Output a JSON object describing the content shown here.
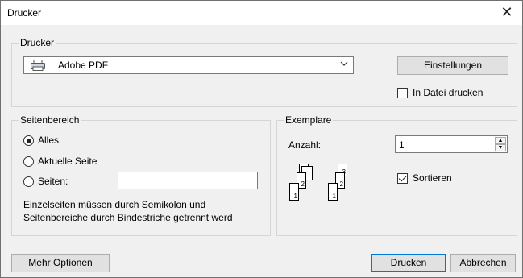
{
  "window": {
    "title": "Drucker"
  },
  "printer": {
    "group_label": "Drucker",
    "selected": "Adobe PDF",
    "settings_button": "Einstellungen",
    "print_to_file_label": "In Datei drucken",
    "print_to_file_checked": false
  },
  "range": {
    "group_label": "Seitenbereich",
    "options": [
      {
        "label": "Alles",
        "selected": true
      },
      {
        "label": "Aktuelle Seite",
        "selected": false
      },
      {
        "label": "Seiten:",
        "selected": false
      }
    ],
    "pages_value": "",
    "note_line1": "Einzelseiten müssen durch Semikolon und",
    "note_line2": "Seitenbereiche durch Bindestriche getrennt werd"
  },
  "copies": {
    "group_label": "Exemplare",
    "count_label": "Anzahl:",
    "count_value": "1",
    "collate_label": "Sortieren",
    "collate_checked": true
  },
  "footer": {
    "more_options": "Mehr Optionen",
    "print": "Drucken",
    "cancel": "Abbrechen"
  },
  "icons": {
    "close": "close-icon",
    "printer": "printer-icon",
    "dropdown": "chevron-down-icon",
    "collate": "collate-pages-icon"
  },
  "colors": {
    "default_button_border": "#0078d7",
    "dialog_bg": "#f0f0f0"
  }
}
